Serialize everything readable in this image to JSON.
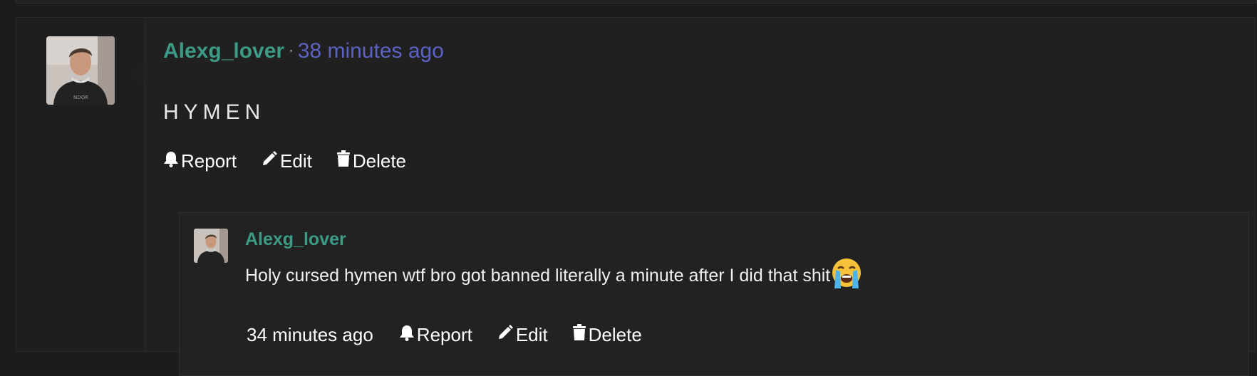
{
  "post": {
    "username": "Alexg_lover",
    "separator": "·",
    "time_ago": "38 minutes ago",
    "body": "HYMEN",
    "actions": {
      "report": "Report",
      "edit": "Edit",
      "delete": "Delete"
    }
  },
  "reply": {
    "username": "Alexg_lover",
    "text": "Holy cursed hymen wtf bro got banned literally a minute after I did that shit",
    "emoji": "loudly-crying-face",
    "time_ago": "34 minutes ago",
    "actions": {
      "report": "Report",
      "edit": "Edit",
      "delete": "Delete"
    }
  },
  "colors": {
    "username": "#3c9a86",
    "timestamp": "#5b62c4",
    "background": "#202020"
  }
}
